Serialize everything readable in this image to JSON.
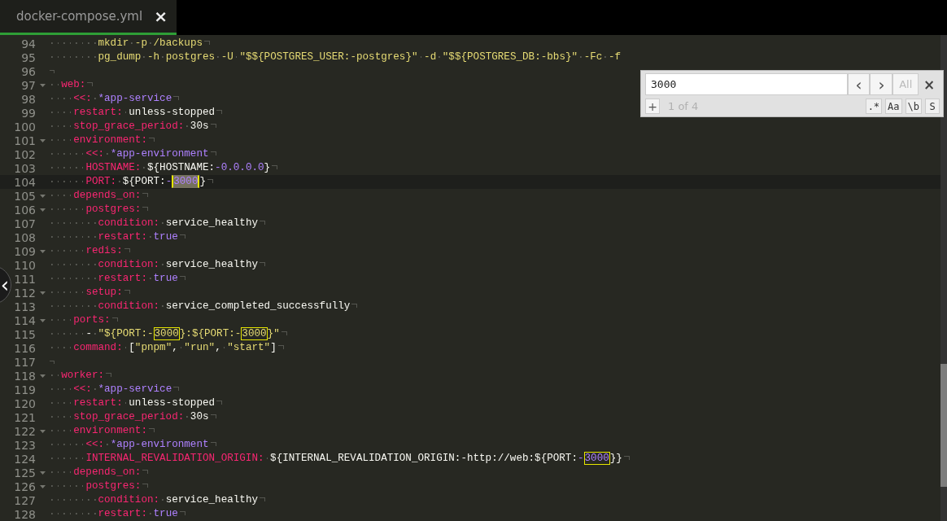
{
  "tab": {
    "title": "docker-compose.yml",
    "close": "×",
    "selected": true
  },
  "find": {
    "value": "3000",
    "prev": "‹",
    "next": "›",
    "all": "All",
    "all_disabled": true,
    "close": "×",
    "add": "+",
    "count": "1 of 4",
    "options": [
      {
        "label": ".*",
        "selected": false
      },
      {
        "label": "Aa",
        "selected": false
      },
      {
        "label": "\\b",
        "selected": false
      },
      {
        "label": "S",
        "selected": false
      }
    ]
  },
  "sidebar_toggle": {
    "label": "‹"
  },
  "lines": [
    {
      "number": "94",
      "foldable": false,
      "current": false,
      "eol": true,
      "tokens": [
        {
          "kind": "str",
          "text": "        mkdir -p /backups"
        }
      ]
    },
    {
      "number": "95",
      "foldable": false,
      "current": false,
      "eol": false,
      "tokens": [
        {
          "kind": "str",
          "text": "        pg_dump -h postgres -U \"$${POSTGRES_USER:-postgres}\" -d \"$${POSTGRES_DB:-bbs}\" -Fc -f"
        }
      ]
    },
    {
      "number": "96",
      "foldable": false,
      "current": false,
      "eol": true
    },
    {
      "number": "97",
      "foldable": true,
      "current": false,
      "eol": true,
      "tokens": [
        {
          "kind": "key",
          "text": "  web:"
        }
      ]
    },
    {
      "number": "98",
      "foldable": false,
      "current": false,
      "eol": true,
      "tokens": [
        {
          "kind": "key",
          "text": "    <<:"
        },
        {
          "kind": "const",
          "text": " *app-service"
        }
      ]
    },
    {
      "number": "99",
      "foldable": false,
      "current": false,
      "eol": true,
      "tokens": [
        {
          "kind": "key",
          "text": "    restart:"
        },
        {
          "kind": "plain",
          "text": " unless-stopped"
        }
      ]
    },
    {
      "number": "100",
      "foldable": false,
      "current": false,
      "eol": true,
      "tokens": [
        {
          "kind": "key",
          "text": "    stop_grace_period:"
        },
        {
          "kind": "plain",
          "text": " 30s"
        }
      ]
    },
    {
      "number": "101",
      "foldable": true,
      "current": false,
      "eol": true,
      "tokens": [
        {
          "kind": "key",
          "text": "    environment:"
        }
      ]
    },
    {
      "number": "102",
      "foldable": false,
      "current": false,
      "eol": true,
      "tokens": [
        {
          "kind": "key",
          "text": "      <<:"
        },
        {
          "kind": "const",
          "text": " *app-environment"
        }
      ]
    },
    {
      "number": "103",
      "foldable": false,
      "current": false,
      "eol": true,
      "tokens": [
        {
          "kind": "key",
          "text": "      HOSTNAME:"
        },
        {
          "kind": "plain",
          "text": " ${HOSTNAME:"
        },
        {
          "kind": "const",
          "text": "-0.0.0.0"
        },
        {
          "kind": "plain",
          "text": "}"
        }
      ]
    },
    {
      "number": "104",
      "foldable": false,
      "current": true,
      "eol": true,
      "tokens": [
        {
          "kind": "key",
          "text": "      PORT:"
        },
        {
          "kind": "plain",
          "text": " ${PORT:"
        },
        {
          "kind": "const",
          "text": "-"
        },
        {
          "kind": "const",
          "text": "3000",
          "found": true,
          "selected": true
        },
        {
          "kind": "plain",
          "text": "}"
        }
      ]
    },
    {
      "number": "105",
      "foldable": true,
      "current": false,
      "eol": true,
      "tokens": [
        {
          "kind": "key",
          "text": "    depends_on:"
        }
      ]
    },
    {
      "number": "106",
      "foldable": true,
      "current": false,
      "eol": true,
      "tokens": [
        {
          "kind": "key",
          "text": "      postgres:"
        }
      ]
    },
    {
      "number": "107",
      "foldable": false,
      "current": false,
      "eol": true,
      "tokens": [
        {
          "kind": "key",
          "text": "        condition:"
        },
        {
          "kind": "plain",
          "text": " service_healthy"
        }
      ]
    },
    {
      "number": "108",
      "foldable": false,
      "current": false,
      "eol": true,
      "tokens": [
        {
          "kind": "key",
          "text": "        restart:"
        },
        {
          "kind": "const",
          "text": " true"
        }
      ]
    },
    {
      "number": "109",
      "foldable": true,
      "current": false,
      "eol": true,
      "tokens": [
        {
          "kind": "key",
          "text": "      redis:"
        }
      ]
    },
    {
      "number": "110",
      "foldable": false,
      "current": false,
      "eol": true,
      "tokens": [
        {
          "kind": "key",
          "text": "        condition:"
        },
        {
          "kind": "plain",
          "text": " service_healthy"
        }
      ]
    },
    {
      "number": "111",
      "foldable": false,
      "current": false,
      "eol": true,
      "tokens": [
        {
          "kind": "key",
          "text": "        restart:"
        },
        {
          "kind": "const",
          "text": " true"
        }
      ]
    },
    {
      "number": "112",
      "foldable": true,
      "current": false,
      "eol": true,
      "tokens": [
        {
          "kind": "key",
          "text": "      setup:"
        }
      ]
    },
    {
      "number": "113",
      "foldable": false,
      "current": false,
      "eol": true,
      "tokens": [
        {
          "kind": "key",
          "text": "        condition:"
        },
        {
          "kind": "plain",
          "text": " service_completed_successfully"
        }
      ]
    },
    {
      "number": "114",
      "foldable": true,
      "current": false,
      "eol": true,
      "tokens": [
        {
          "kind": "key",
          "text": "    ports:"
        }
      ]
    },
    {
      "number": "115",
      "foldable": false,
      "current": false,
      "eol": true,
      "tokens": [
        {
          "kind": "plain",
          "text": "      - "
        },
        {
          "kind": "str",
          "text": "\"${PORT:-"
        },
        {
          "kind": "str",
          "text": "3000",
          "found": true,
          "selected": false
        },
        {
          "kind": "str",
          "text": "}:${PORT:-"
        },
        {
          "kind": "str",
          "text": "3000",
          "found": true,
          "selected": false
        },
        {
          "kind": "str",
          "text": "}\""
        }
      ]
    },
    {
      "number": "116",
      "foldable": false,
      "current": false,
      "eol": true,
      "tokens": [
        {
          "kind": "key",
          "text": "    command:"
        },
        {
          "kind": "plain",
          "text": " ["
        },
        {
          "kind": "str",
          "text": "\"pnpm\""
        },
        {
          "kind": "plain",
          "text": ", "
        },
        {
          "kind": "str",
          "text": "\"run\""
        },
        {
          "kind": "plain",
          "text": ", "
        },
        {
          "kind": "str",
          "text": "\"start\""
        },
        {
          "kind": "plain",
          "text": "]"
        }
      ]
    },
    {
      "number": "117",
      "foldable": false,
      "current": false,
      "eol": true
    },
    {
      "number": "118",
      "foldable": true,
      "current": false,
      "eol": true,
      "tokens": [
        {
          "kind": "key",
          "text": "  worker:"
        }
      ]
    },
    {
      "number": "119",
      "foldable": false,
      "current": false,
      "eol": true,
      "tokens": [
        {
          "kind": "key",
          "text": "    <<:"
        },
        {
          "kind": "const",
          "text": " *app-service"
        }
      ]
    },
    {
      "number": "120",
      "foldable": false,
      "current": false,
      "eol": true,
      "tokens": [
        {
          "kind": "key",
          "text": "    restart:"
        },
        {
          "kind": "plain",
          "text": " unless-stopped"
        }
      ]
    },
    {
      "number": "121",
      "foldable": false,
      "current": false,
      "eol": true,
      "tokens": [
        {
          "kind": "key",
          "text": "    stop_grace_period:"
        },
        {
          "kind": "plain",
          "text": " 30s"
        }
      ]
    },
    {
      "number": "122",
      "foldable": true,
      "current": false,
      "eol": true,
      "tokens": [
        {
          "kind": "key",
          "text": "    environment:"
        }
      ]
    },
    {
      "number": "123",
      "foldable": false,
      "current": false,
      "eol": true,
      "tokens": [
        {
          "kind": "key",
          "text": "      <<:"
        },
        {
          "kind": "const",
          "text": " *app-environment"
        }
      ]
    },
    {
      "number": "124",
      "foldable": false,
      "current": false,
      "eol": true,
      "tokens": [
        {
          "kind": "key",
          "text": "      INTERNAL_REVALIDATION_ORIGIN:"
        },
        {
          "kind": "plain",
          "text": " ${INTERNAL_REVALIDATION_ORIGIN:-http://web:${PORT:"
        },
        {
          "kind": "const",
          "text": "-"
        },
        {
          "kind": "const",
          "text": "3000",
          "found": true,
          "selected": false
        },
        {
          "kind": "plain",
          "text": "}}"
        }
      ]
    },
    {
      "number": "125",
      "foldable": true,
      "current": false,
      "eol": true,
      "tokens": [
        {
          "kind": "key",
          "text": "    depends_on:"
        }
      ]
    },
    {
      "number": "126",
      "foldable": true,
      "current": false,
      "eol": true,
      "tokens": [
        {
          "kind": "key",
          "text": "      postgres:"
        }
      ]
    },
    {
      "number": "127",
      "foldable": false,
      "current": false,
      "eol": true,
      "tokens": [
        {
          "kind": "key",
          "text": "        condition:"
        },
        {
          "kind": "plain",
          "text": " service_healthy"
        }
      ]
    },
    {
      "number": "128",
      "foldable": false,
      "current": false,
      "eol": true,
      "tokens": [
        {
          "kind": "key",
          "text": "        restart:"
        },
        {
          "kind": "const",
          "text": " true"
        }
      ]
    }
  ]
}
